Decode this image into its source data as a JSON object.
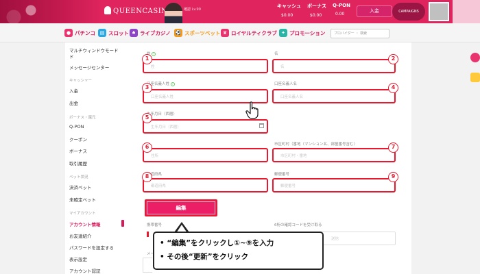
{
  "header": {
    "logo": "QUEENCASINO",
    "user_hint": "確認 Lv.99",
    "stats": [
      {
        "label": "キャッシュ",
        "value": "$0.00"
      },
      {
        "label": "ボーナス",
        "value": "$0.00"
      },
      {
        "label": "Q-PON",
        "value": "0.00"
      }
    ],
    "deposit_label": "入金",
    "promo_label": "CAMPAIGNS"
  },
  "nav": {
    "items": [
      {
        "label": "パチンコ",
        "color": "#e8336e"
      },
      {
        "label": "スロット",
        "color": "#2aa7e0"
      },
      {
        "label": "ライブカジノ",
        "color": "#8e44c9"
      },
      {
        "label": "スポーツベット",
        "color": "#f29a1c"
      },
      {
        "label": "ロイヤルティクラブ",
        "color": "#e8336e"
      },
      {
        "label": "プロモーション",
        "color": "#2bb3a6"
      }
    ],
    "search_placeholder": "プロバイダー ・ 検索"
  },
  "sidebar": {
    "items": [
      {
        "label": "マルチウィンドウモード",
        "type": "item"
      },
      {
        "label": "ド",
        "type": "item"
      },
      {
        "label": "メッセージセンター",
        "type": "item"
      },
      {
        "label": "キャッシャー",
        "type": "head"
      },
      {
        "label": "入金",
        "type": "item"
      },
      {
        "label": "出金",
        "type": "item"
      },
      {
        "label": "ボーナス・還元",
        "type": "head"
      },
      {
        "label": "Q-PON",
        "type": "item"
      },
      {
        "label": "クーポン",
        "type": "item"
      },
      {
        "label": "ボーナス",
        "type": "item"
      },
      {
        "label": "取引履歴",
        "type": "item"
      },
      {
        "label": "ベット状況",
        "type": "head"
      },
      {
        "label": "決済ベット",
        "type": "item"
      },
      {
        "label": "未確定ベット",
        "type": "item"
      },
      {
        "label": "マイアカウント",
        "type": "head"
      },
      {
        "label": "アカウント情報",
        "type": "active"
      },
      {
        "label": "お友達紹介",
        "type": "item"
      },
      {
        "label": "パスワードを設定する",
        "type": "item"
      },
      {
        "label": "表示設定",
        "type": "item"
      },
      {
        "label": "アカウント認証",
        "type": "item"
      }
    ]
  },
  "form": {
    "fields": [
      {
        "num": "1",
        "label": "姓",
        "placeholder": "姓"
      },
      {
        "num": "2",
        "label": "名",
        "placeholder": "名"
      },
      {
        "num": "3",
        "label": "口座名義人姓",
        "placeholder": "口座名義人姓"
      },
      {
        "num": "4",
        "label": "口座名義人名",
        "placeholder": "口座名義人名"
      },
      {
        "num": "5",
        "label": "生年月日（西暦）",
        "placeholder": "生年月日（西暦）"
      },
      {
        "num": "6",
        "label": "住所",
        "placeholder": "住所"
      },
      {
        "num": "7",
        "label": "市区町村（番地（マンション名、部屋番号含む）",
        "placeholder": "市区町村・番地"
      },
      {
        "num": "8",
        "label": "都道府県",
        "placeholder": "都道府県"
      },
      {
        "num": "9",
        "label": "郵便番号",
        "placeholder": "郵便番号"
      }
    ],
    "edit_label": "編集",
    "phone_label": "携帯番号",
    "code_label": "6桁の確認コードを受け取る",
    "email_label": "メール",
    "code_button": "送信"
  },
  "callout": {
    "line1": "• “編集”をクリックし①~⑨を入力",
    "line2": "• その後“更新”をクリック"
  }
}
